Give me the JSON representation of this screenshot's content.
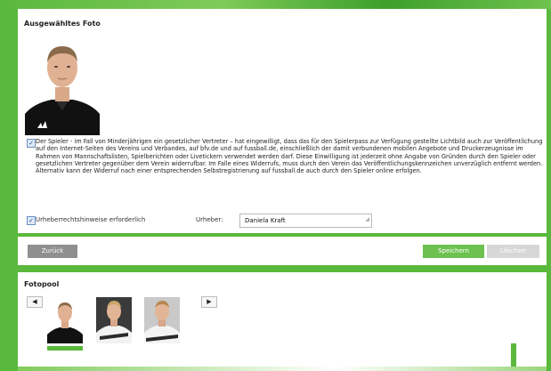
{
  "selected_photo": {
    "title": "Ausgewähltes Foto",
    "consent_checked": true,
    "consent_text": "Der Spieler - im Fall von Minderjährigen ein gesetzlicher Vertreter – hat eingewilligt, dass das für den Spielerpass zur Verfügung gestellte Lichtbild auch zur Veröffentlichung auf den Internet-Seiten des Vereins und Verbandes, auf bfv.de und auf fussball.de, einschließlich der damit verbundenen mobilen Angebote und Druckerzeugnisse im Rahmen von Mannschaftslisten, Spielberichten oder Livetickern verwendet werden darf. Diese Einwilligung ist jederzeit ohne Angabe von Gründen durch den Spieler oder gesetzlichen Vertreter gegenüber dem Verein widerrufbar. Im Falle eines Widerrufs, muss durch den Verein das Veröffentlichungskennzeichen unverzüglich entfernt werden. Alternativ kann der Widerruf nach einer entsprechenden Selbstregistrierung auf fussball.de auch durch den Spieler online erfolgen.",
    "copyright_checked": true,
    "copyright_label": "Urheberrechtshinweise erforderlich",
    "author_label": "Urheber:",
    "author_value": "Daniela Kraft"
  },
  "actions": {
    "back_label": "Zurück",
    "save_label": "Speichern",
    "delete_label": "Löschen"
  },
  "photo_pool": {
    "title": "Fotopool",
    "prev_icon": "triangle-left-icon",
    "next_icon": "triangle-right-icon",
    "selected_index": 0
  },
  "colors": {
    "accent": "#5ab83c",
    "save_button": "#6cc14f",
    "back_button": "#8f8f8f",
    "delete_button_disabled": "#d7d7d7"
  }
}
